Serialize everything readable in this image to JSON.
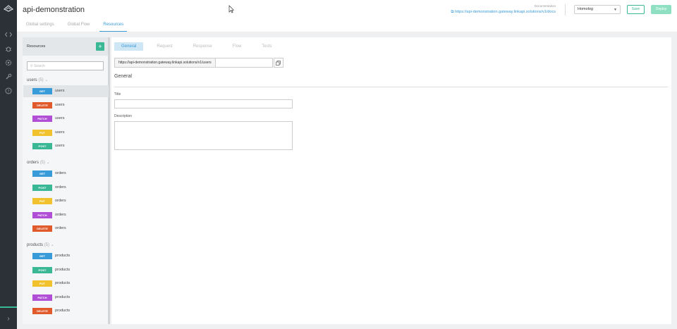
{
  "header": {
    "title": "api-demonstration",
    "documentation_label": "Documentation",
    "documentation_url": "https://api-demonstration.gateway.linkapi.solutions/v1/docs",
    "environment": "Homolog",
    "save_label": "Save",
    "deploy_label": "Deploy"
  },
  "top_tabs": [
    {
      "label": "Global settings"
    },
    {
      "label": "Global Flow"
    },
    {
      "label": "Resources"
    }
  ],
  "sidebar": {
    "title": "Resources",
    "add_label": "+",
    "search_placeholder": "Search",
    "groups": [
      {
        "name": "users",
        "count": "(5)",
        "items": [
          {
            "method": "GET",
            "color": "#3a9bd9",
            "label": "users"
          },
          {
            "method": "DELETE",
            "color": "#e05a2b",
            "label": "users"
          },
          {
            "method": "PATCH",
            "color": "#b04fd6",
            "label": "users"
          },
          {
            "method": "PUT",
            "color": "#f2c12e",
            "label": "users"
          },
          {
            "method": "POST",
            "color": "#3ab795",
            "label": "users"
          }
        ]
      },
      {
        "name": "orders",
        "count": "(5)",
        "items": [
          {
            "method": "GET",
            "color": "#3a9bd9",
            "label": "orders"
          },
          {
            "method": "POST",
            "color": "#3ab795",
            "label": "orders"
          },
          {
            "method": "PUT",
            "color": "#f2c12e",
            "label": "orders"
          },
          {
            "method": "PATCH",
            "color": "#b04fd6",
            "label": "orders"
          },
          {
            "method": "DELETE",
            "color": "#e05a2b",
            "label": "orders"
          }
        ]
      },
      {
        "name": "products",
        "count": "(5)",
        "items": [
          {
            "method": "GET",
            "color": "#3a9bd9",
            "label": "products"
          },
          {
            "method": "POST",
            "color": "#3ab795",
            "label": "products"
          },
          {
            "method": "PUT",
            "color": "#f2c12e",
            "label": "products"
          },
          {
            "method": "PATCH",
            "color": "#b04fd6",
            "label": "products"
          },
          {
            "method": "DELETE",
            "color": "#e05a2b",
            "label": "products"
          }
        ]
      }
    ]
  },
  "main": {
    "tabs": [
      {
        "label": "General"
      },
      {
        "label": "Request"
      },
      {
        "label": "Response"
      },
      {
        "label": "Flow"
      },
      {
        "label": "Tests"
      }
    ],
    "url": "https://api-demonstration.gateway.linkapi.solutions/v1/users",
    "section_title": "General",
    "title_label": "Title",
    "description_label": "Description"
  }
}
